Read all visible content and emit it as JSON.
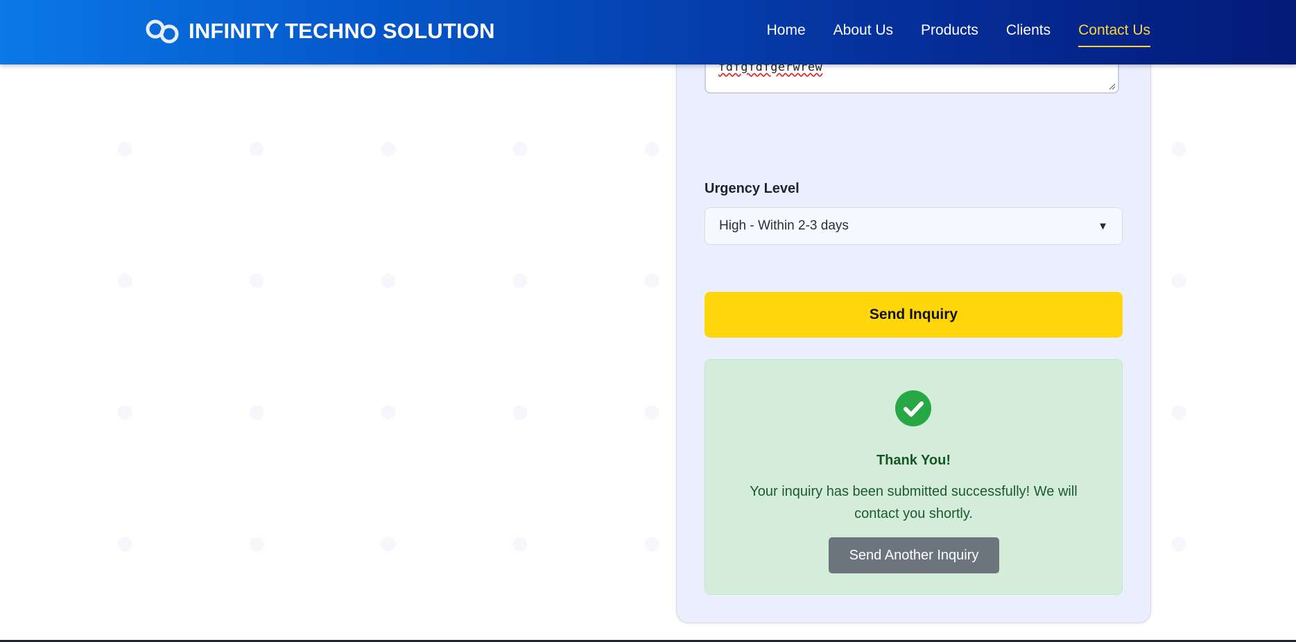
{
  "header": {
    "brand_name": "INFINITY TECHNO SOLUTION",
    "logo_icon": "infinity-icon",
    "nav": [
      {
        "label": "Home",
        "active": false
      },
      {
        "label": "About Us",
        "active": false
      },
      {
        "label": "Products",
        "active": false
      },
      {
        "label": "Clients",
        "active": false
      },
      {
        "label": "Contact Us",
        "active": true
      }
    ]
  },
  "form": {
    "message_value": "fdfgfdfgerwrew",
    "urgency_label": "Urgency Level",
    "urgency_selected": "High - Within 2-3 days",
    "submit_label": "Send Inquiry"
  },
  "success": {
    "icon": "check-circle-icon",
    "title": "Thank You!",
    "message": "Your inquiry has been submitted successfully! We will contact you shortly.",
    "button_label": "Send Another Inquiry"
  },
  "colors": {
    "header_gradient_start": "#0a78e6",
    "header_gradient_end": "#041a78",
    "nav_active": "#ffd43b",
    "card_background": "#eaeefd",
    "submit_button": "#ffd60a",
    "success_background": "#d4edda",
    "success_icon": "#28a745",
    "success_text": "#155724",
    "secondary_button": "#6c757d"
  }
}
